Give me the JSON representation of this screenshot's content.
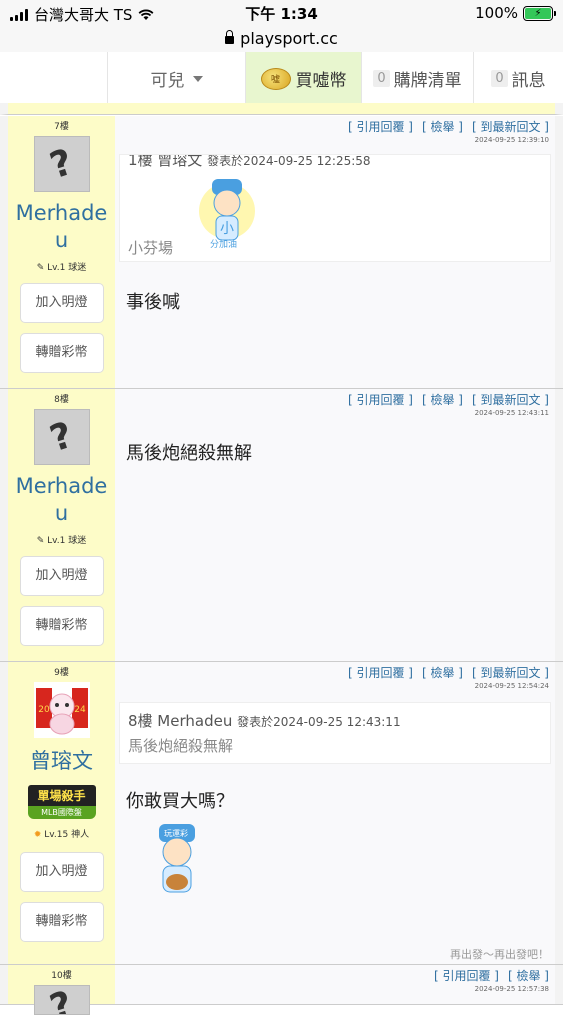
{
  "status_bar": {
    "carrier": "台灣大哥大 TS",
    "time": "下午 1:34",
    "battery": "100%"
  },
  "url_bar": {
    "url": "playsport.cc"
  },
  "nav": {
    "user": "可兒",
    "buy_label": "買噓幣",
    "coin_text": "噓",
    "cart_count": "0",
    "cart_label": "購牌清單",
    "msg_count": "0",
    "msg_label": "訊息"
  },
  "actions": {
    "quote": "[ 引用回覆 ]",
    "report": "[ 檢舉 ]",
    "latest": "[ 到最新回文 ]",
    "add_light": "加入明燈",
    "gift_coin": "轉贈彩幣"
  },
  "posts": [
    {
      "floor": "7樓",
      "username": "Merhadeu",
      "level": "Lv.1 球迷",
      "time": "2024-09-25 12:39:10",
      "quote_head": "1樓 曾瑢文",
      "quote_posted": "發表於2024-09-25 12:25:58",
      "quote_body": "小芬場",
      "quote_sticker": "分加油",
      "content": "事後喊"
    },
    {
      "floor": "8樓",
      "username": "Merhadeu",
      "level": "Lv.1 球迷",
      "time": "2024-09-25 12:43:11",
      "content": "馬後炮絕殺無解"
    },
    {
      "floor": "9樓",
      "username": "曾瑢文",
      "badge_title": "單場殺手",
      "badge_sub": "MLB國際盤",
      "level": "Lv.15 神人",
      "time": "2024-09-25 12:54:24",
      "quote_head": "8樓 Merhadeu",
      "quote_posted": "發表於2024-09-25 12:43:11",
      "quote_body": "馬後炮絕殺無解",
      "content": "你敢買大嗎？",
      "sticker_text": "玩運彩",
      "footer": "再出發～再出發吧！"
    },
    {
      "floor": "10樓",
      "time": "2024-09-25 12:57:38"
    }
  ],
  "icons": {
    "default_avatar": "question-mark-avatar",
    "dragon_avatar": "dragon-avatar"
  },
  "colors": {
    "side_bg": "#fdfcc8",
    "link": "#2f6fa0",
    "buy_bg": "#e8f6cf"
  }
}
